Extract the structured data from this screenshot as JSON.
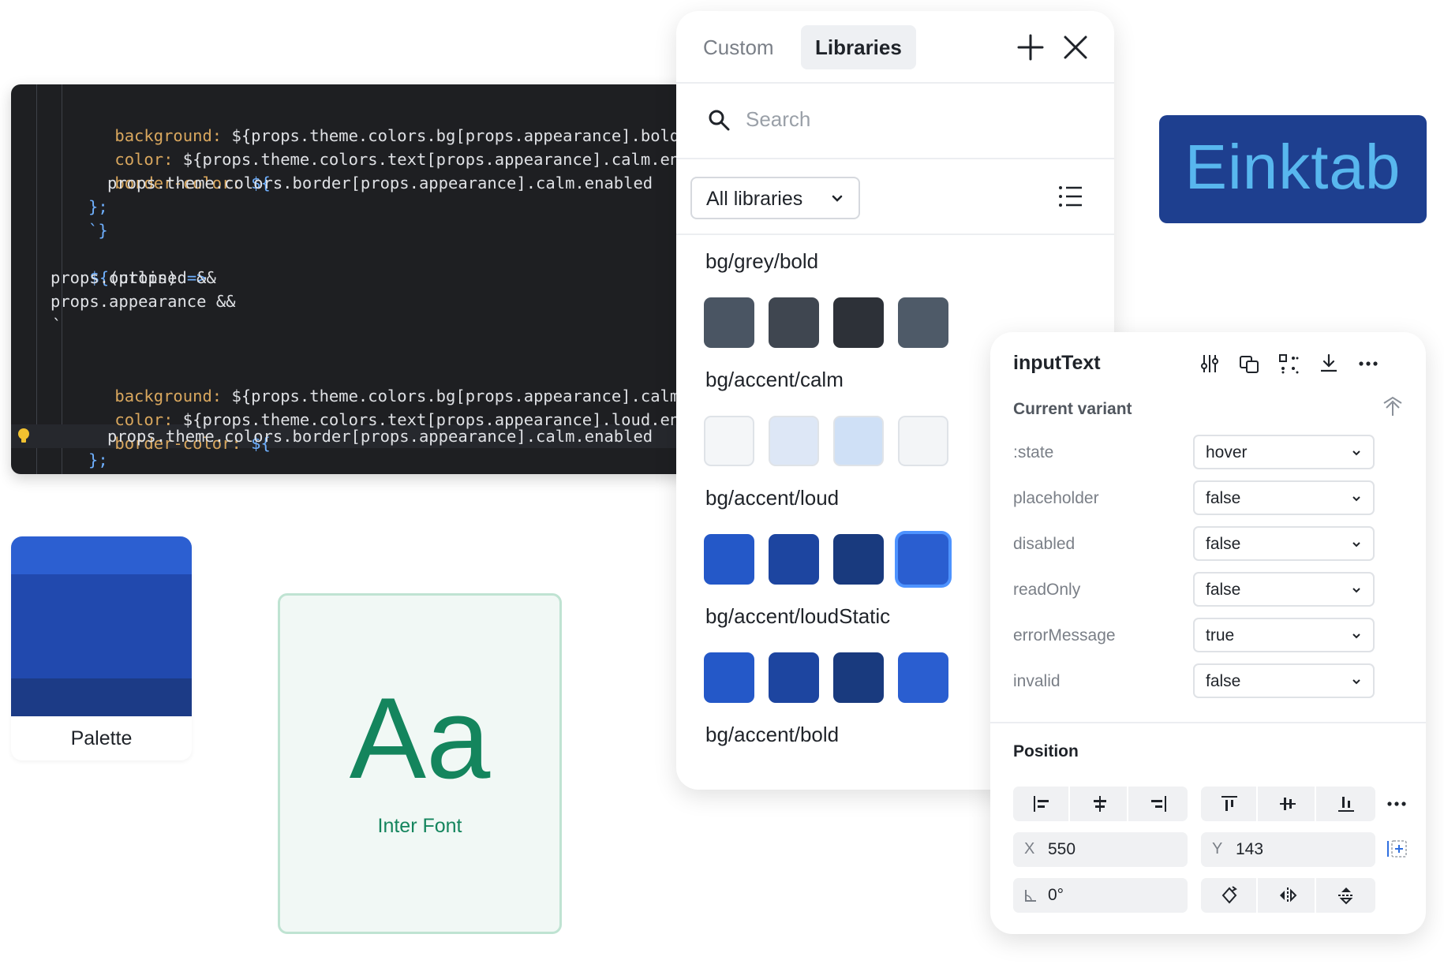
{
  "code": {
    "lines": [
      "`",
      "background: ${props.theme.colors.bg[props.appearance].bold.ena",
      "color: ${props.theme.colors.text[props.appearance].calm.enable",
      "border-color: ${",
      "props.theme.colors.border[props.appearance].calm.enabled",
      "};",
      "`}",
      "${(props) =>",
      "props.outlined &&",
      "props.appearance &&",
      "`",
      "",
      "background: ${props.theme.colors.bg[props.appearance].calm.ena",
      "color: ${props.theme.colors.text[props.appearance].loud.enable",
      "border-color: ${",
      "props.theme.colors.border[props.appearance].calm.enabled",
      "};"
    ],
    "colors": {
      "bg": "#1e1f22",
      "property": "#d9a75e",
      "text": "#dfe1e5",
      "brace": "#6fb0ff"
    }
  },
  "libraries": {
    "tabs": [
      {
        "label": "Custom",
        "active": false
      },
      {
        "label": "Libraries",
        "active": true
      }
    ],
    "add_icon": "plus-icon",
    "close_icon": "close-icon",
    "search": {
      "placeholder": "Search",
      "icon": "search-icon"
    },
    "filter": {
      "selected": "All libraries",
      "icon": "chevron-down-icon"
    },
    "view_icon": "list-icon",
    "groups": [
      {
        "name": "bg/grey/bold",
        "swatches": [
          "#4a5563",
          "#3f4650",
          "#2d3138",
          "#4e5a68"
        ]
      },
      {
        "name": "bg/accent/calm",
        "swatches": [
          "#f4f6f8",
          "#dde7f6",
          "#cfe0f6",
          "#f3f5f7"
        ]
      },
      {
        "name": "bg/accent/loud",
        "swatches": [
          "#2458c8",
          "#1d45a0",
          "#193a7e",
          "#2a5ed0"
        ],
        "selected_index": 3
      },
      {
        "name": "bg/accent/loudStatic",
        "swatches": [
          "#2458c8",
          "#1d45a0",
          "#193a7e",
          "#2a5ed0"
        ]
      },
      {
        "name": "bg/accent/bold",
        "swatches": []
      }
    ]
  },
  "logo": {
    "text": "Einktab",
    "bg": "#1e3f8f",
    "color": "#58b7ee"
  },
  "palette": {
    "label": "Palette",
    "bands": [
      "#2c5fd1",
      "#2149ae",
      "#1c3b86"
    ]
  },
  "font_card": {
    "sample": "Aa",
    "name": "Inter Font",
    "color": "#14855d"
  },
  "properties": {
    "title": "inputText",
    "icons": [
      "sliders-icon",
      "swap-instance-icon",
      "component-grid-icon",
      "download-icon",
      "more-icon"
    ],
    "section": "Current variant",
    "reset_icon": "push-to-main-icon",
    "rows": [
      {
        "label": ":state",
        "value": "hover"
      },
      {
        "label": "placeholder",
        "value": "false"
      },
      {
        "label": "disabled",
        "value": "false"
      },
      {
        "label": "readOnly",
        "value": "false"
      },
      {
        "label": "errorMessage",
        "value": "true"
      },
      {
        "label": "invalid",
        "value": "false"
      }
    ],
    "position": {
      "title": "Position",
      "x_label": "X",
      "x": "550",
      "y_label": "Y",
      "y": "143",
      "rotation": "0°",
      "align_buttons": [
        "align-left-icon",
        "align-center-h-icon",
        "align-right-icon",
        "align-top-icon",
        "align-center-v-icon",
        "align-bottom-icon"
      ],
      "transform_buttons": [
        "rotate-icon",
        "flip-horizontal-icon",
        "flip-vertical-icon"
      ]
    }
  }
}
